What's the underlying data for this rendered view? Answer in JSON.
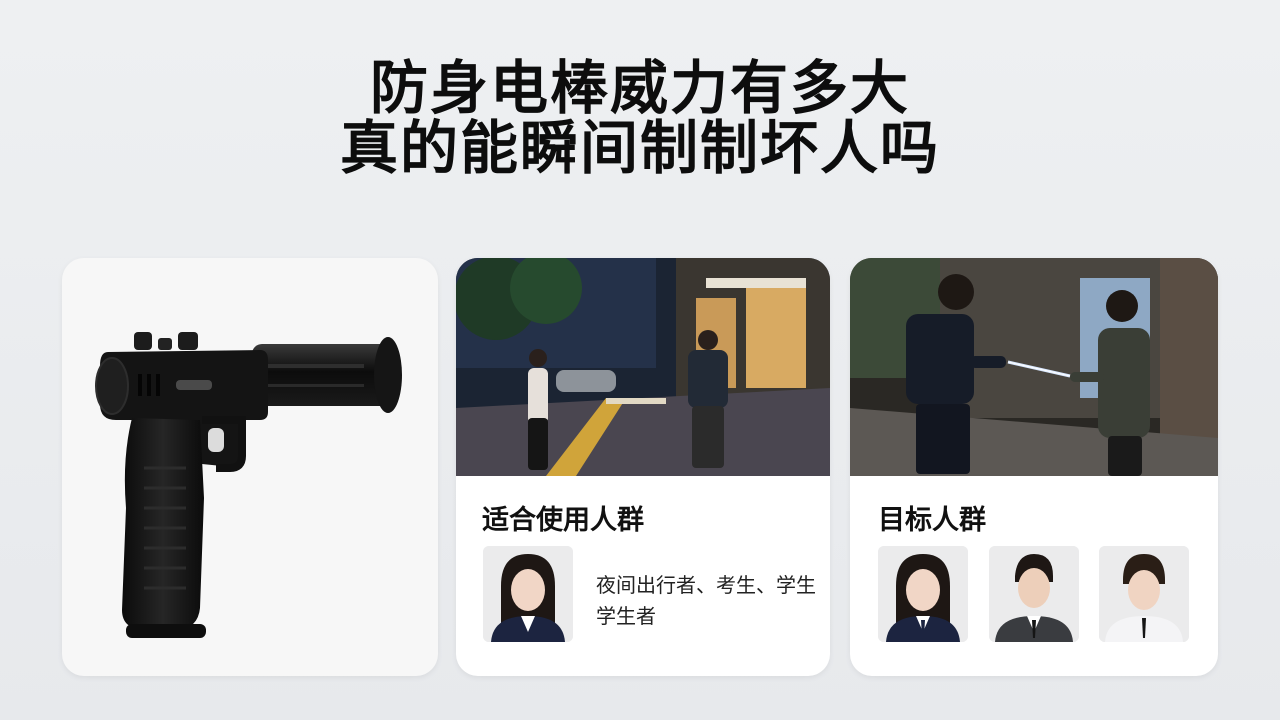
{
  "headline": {
    "line1": "防身电棒威力有多大",
    "line2": "真的能瞬间制制坏人吗"
  },
  "cards": {
    "product": {
      "image_icon": "stun-gun-icon"
    },
    "suitable_users": {
      "title": "适合使用人群",
      "scene_icon": "night-street-photo-icon",
      "portrait_icon": "female-student-portrait-icon",
      "description": "夜间出行者、考生、学生学生者"
    },
    "target_people": {
      "title": "目标人群",
      "scene_icon": "guard-and-woman-night-photo-icon",
      "portraits": [
        "female-portrait-icon",
        "male-suit-portrait-icon",
        "male-shirt-portrait-icon"
      ]
    }
  },
  "colors": {
    "background": "#eceef0",
    "card": "#ffffff",
    "title_text": "#0d0d0d",
    "night_sky": "#1b2433"
  }
}
